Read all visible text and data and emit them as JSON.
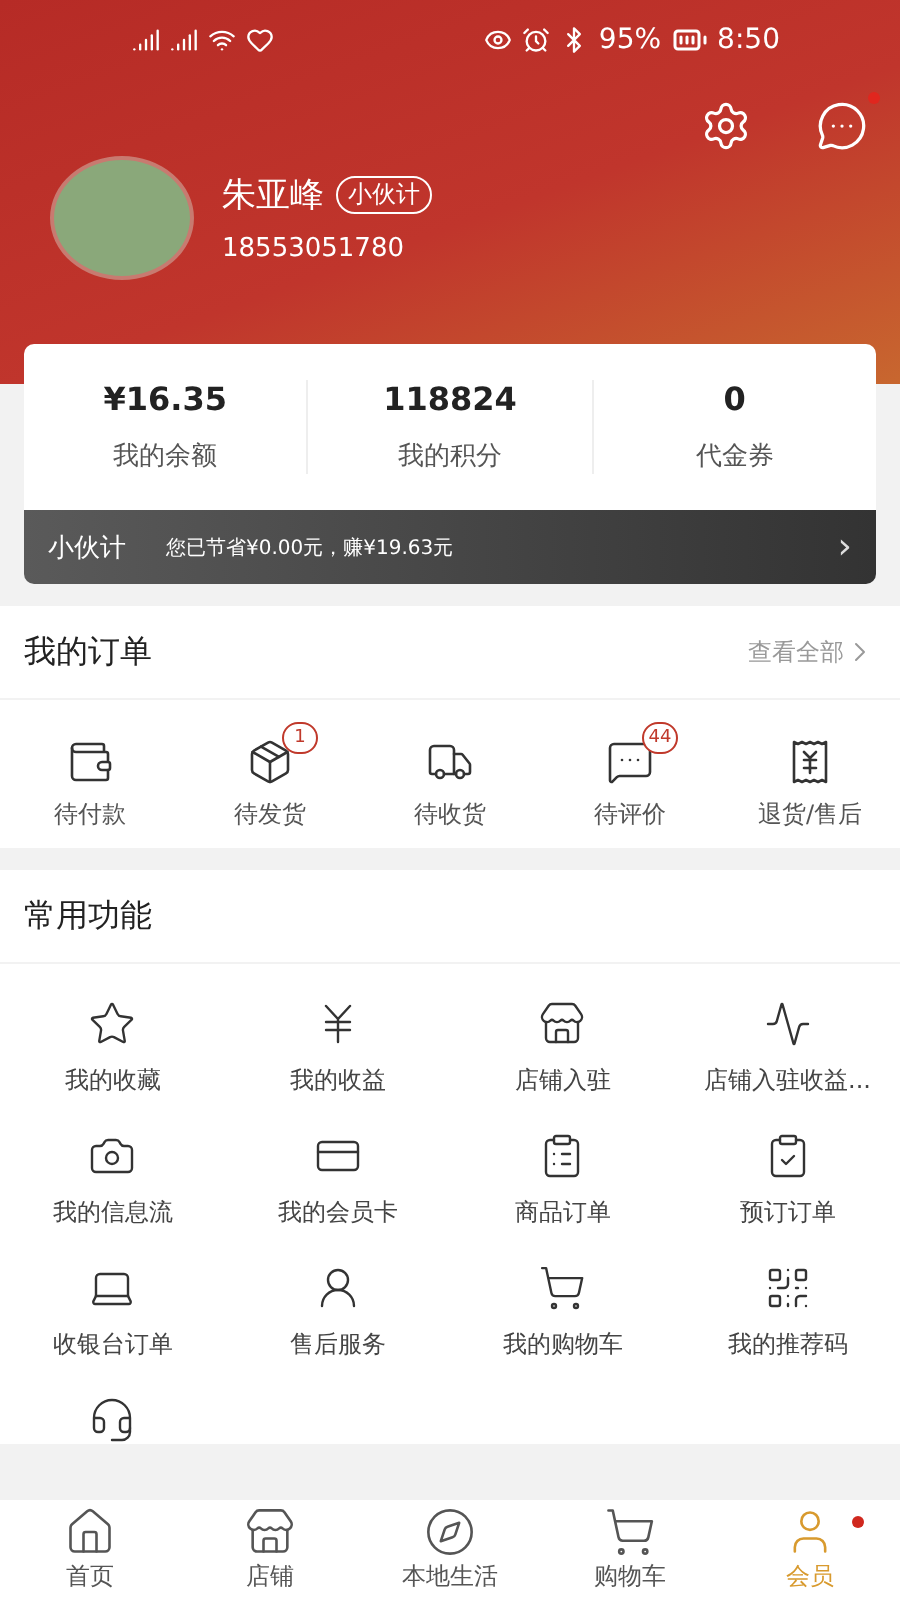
{
  "status_bar": {
    "battery": "95%",
    "time": "8:50"
  },
  "profile": {
    "name": "朱亚峰",
    "role_badge": "小伙计",
    "phone": "18553051780",
    "messages_unread": true
  },
  "stats": [
    {
      "value": "¥16.35",
      "label": "我的余额"
    },
    {
      "value": "118824",
      "label": "我的积分"
    },
    {
      "value": "0",
      "label": "代金券"
    }
  ],
  "partner_bar": {
    "title": "小伙计",
    "text": "您已节省¥0.00元，赚¥19.63元",
    "arrow": "›"
  },
  "orders": {
    "title": "我的订单",
    "view_all": "查看全部",
    "items": [
      {
        "kind": "wallet",
        "label": "待付款"
      },
      {
        "kind": "package",
        "label": "待发货",
        "badge": "1"
      },
      {
        "kind": "truck",
        "label": "待收货"
      },
      {
        "kind": "comment",
        "label": "待评价",
        "badge": "44"
      },
      {
        "kind": "refund",
        "label": "退货/售后"
      }
    ]
  },
  "features": {
    "title": "常用功能",
    "items": [
      {
        "kind": "star",
        "label": "我的收藏"
      },
      {
        "kind": "yen",
        "label": "我的收益"
      },
      {
        "kind": "store",
        "label": "店铺入驻"
      },
      {
        "kind": "chart",
        "label": "店铺入驻收益..."
      },
      {
        "kind": "camera",
        "label": "我的信息流"
      },
      {
        "kind": "card",
        "label": "我的会员卡"
      },
      {
        "kind": "clipboard",
        "label": "商品订单"
      },
      {
        "kind": "clipcheck",
        "label": "预订订单"
      },
      {
        "kind": "laptop",
        "label": "收银台订单"
      },
      {
        "kind": "service",
        "label": "售后服务"
      },
      {
        "kind": "cart",
        "label": "我的购物车"
      },
      {
        "kind": "qr",
        "label": "我的推荐码"
      },
      {
        "kind": "headset"
      }
    ]
  },
  "tab_bar": [
    {
      "kind": "home",
      "label": "首页",
      "selected": false,
      "dot": false
    },
    {
      "kind": "store",
      "label": "店铺",
      "selected": false,
      "dot": false
    },
    {
      "kind": "compass",
      "label": "本地生活",
      "selected": false,
      "dot": false
    },
    {
      "kind": "cart",
      "label": "购物车",
      "selected": false,
      "dot": false
    },
    {
      "kind": "user",
      "label": "会员",
      "selected": true,
      "dot": true
    }
  ]
}
